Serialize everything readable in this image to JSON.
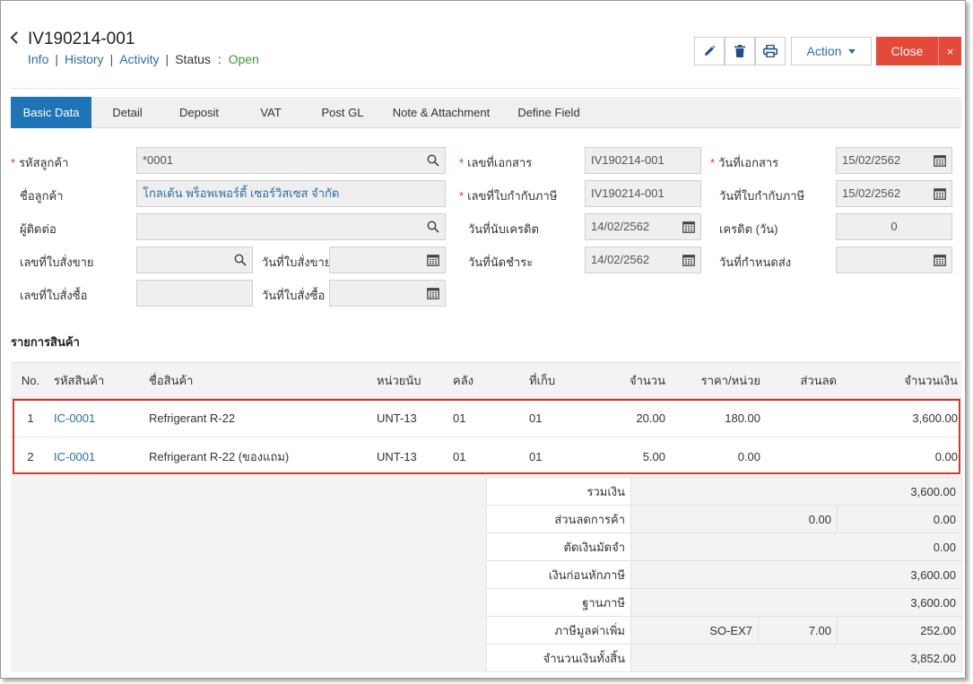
{
  "header": {
    "doc_no": "IV190214-001",
    "links": {
      "info": "Info",
      "history": "History",
      "activity": "Activity"
    },
    "status_label": "Status",
    "status_colon": ":",
    "status_value": "Open",
    "action_label": "Action",
    "close_label": "Close",
    "close_x": "×"
  },
  "tabs": [
    "Basic Data",
    "Detail",
    "Deposit",
    "VAT",
    "Post GL",
    "Note & Attachment",
    "Define Field"
  ],
  "form": {
    "customer_code_label": "รหัสลูกค้า",
    "customer_code": "*0001",
    "customer_name_label": "ชื่อลูกค้า",
    "customer_name": "โกลเด้น พร็อพเพอร์ตี้ เซอร์วิสเซส จำกัด",
    "contact_label": "ผู้ติดต่อ",
    "contact": "",
    "so_no_label": "เลขที่ใบสั่งขาย",
    "so_no": "",
    "so_date_label": "วันที่ใบสั่งขาย",
    "so_date": "",
    "po_no_label": "เลขที่ใบสั่งซื้อ",
    "po_no": "",
    "po_date_label": "วันที่ใบสั่งซื้อ",
    "po_date": "",
    "doc_no_label": "เลขที่เอกสาร",
    "doc_no": "IV190214-001",
    "tax_inv_no_label": "เลขที่ใบกำกับภาษี",
    "tax_inv_no": "IV190214-001",
    "credit_start_label": "วันที่นับเครดิต",
    "credit_start": "14/02/2562",
    "due_date_label": "วันที่นัดชำระ",
    "due_date": "14/02/2562",
    "doc_date_label": "วันที่เอกสาร",
    "doc_date": "15/02/2562",
    "tax_inv_date_label": "วันที่ใบกำกับภาษี",
    "tax_inv_date": "15/02/2562",
    "credit_days_label": "เครดิต (วัน)",
    "credit_days": "0",
    "delivery_date_label": "วันที่กำหนดส่ง",
    "delivery_date": ""
  },
  "items_title": "รายการสินค้า",
  "items": {
    "columns": [
      "No.",
      "รหัสสินค้า",
      "ชื่อสินค้า",
      "หน่วยนับ",
      "คลัง",
      "ที่เก็บ",
      "จำนวน",
      "ราคา/หน่วย",
      "ส่วนลด",
      "จำนวนเงิน"
    ],
    "rows": [
      {
        "no": "1",
        "code": "IC-0001",
        "name": "Refrigerant R-22",
        "unit": "UNT-13",
        "wh": "01",
        "loc": "01",
        "qty": "20.00",
        "price": "180.00",
        "disc": "",
        "amount": "3,600.00"
      },
      {
        "no": "2",
        "code": "IC-0001",
        "name": "Refrigerant R-22 (ของแถม)",
        "unit": "UNT-13",
        "wh": "01",
        "loc": "01",
        "qty": "5.00",
        "price": "0.00",
        "disc": "",
        "amount": "0.00"
      }
    ]
  },
  "summary": {
    "total_label": "รวมเงิน",
    "total": "3,600.00",
    "trade_disc_label": "ส่วนลดการค้า",
    "trade_disc_value": "0.00",
    "trade_disc_amount": "0.00",
    "deposit_label": "ตัดเงินมัดจำ",
    "deposit": "0.00",
    "pre_tax_label": "เงินก่อนหักภาษี",
    "pre_tax": "3,600.00",
    "tax_base_label": "ฐานภาษี",
    "tax_base": "3,600.00",
    "vat_label": "ภาษีมูลค่าเพิ่ม",
    "vat_code": "SO-EX7",
    "vat_rate": "7.00",
    "vat_amount": "252.00",
    "grand_total_label": "จำนวนเงินทั้งสิ้น",
    "grand_total": "3,852.00"
  }
}
